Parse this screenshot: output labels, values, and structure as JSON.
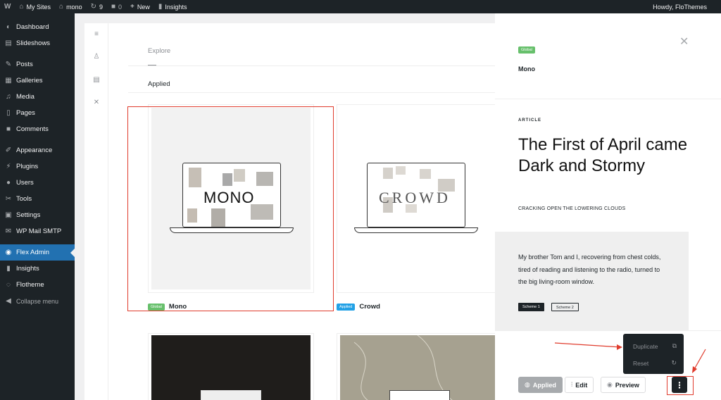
{
  "adminbar": {
    "wp_logo": "W",
    "my_sites": "My Sites",
    "site": "mono",
    "updates": "9",
    "comments": "0",
    "new": "New",
    "insights": "Insights",
    "howdy": "Howdy, FloThemes"
  },
  "sidebar": {
    "items": [
      {
        "label": "Dashboard",
        "icon": "dashboard-icon"
      },
      {
        "label": "Slideshows",
        "icon": "slideshows-icon"
      },
      {
        "label": "Posts",
        "icon": "pin-icon"
      },
      {
        "label": "Galleries",
        "icon": "gallery-icon"
      },
      {
        "label": "Media",
        "icon": "media-icon"
      },
      {
        "label": "Pages",
        "icon": "pages-icon"
      },
      {
        "label": "Comments",
        "icon": "comment-icon"
      },
      {
        "label": "Appearance",
        "icon": "brush-icon"
      },
      {
        "label": "Plugins",
        "icon": "plug-icon"
      },
      {
        "label": "Users",
        "icon": "user-icon"
      },
      {
        "label": "Tools",
        "icon": "wrench-icon"
      },
      {
        "label": "Settings",
        "icon": "settings-icon"
      },
      {
        "label": "WP Mail SMTP",
        "icon": "mail-icon"
      },
      {
        "label": "Flex Admin",
        "icon": "flex-icon"
      },
      {
        "label": "Insights",
        "icon": "chart-icon"
      },
      {
        "label": "Flotheme",
        "icon": "flotheme-icon"
      },
      {
        "label": "Collapse menu",
        "icon": "collapse-icon"
      }
    ]
  },
  "main": {
    "tab_explore": "Explore",
    "tab_applied": "Applied",
    "cards": [
      {
        "name": "Mono",
        "badge": "Global",
        "screen_text": "MONO"
      },
      {
        "name": "Crowd",
        "badge": "Applied",
        "screen_text": "CROWD"
      }
    ]
  },
  "panel": {
    "badge": "Global",
    "name": "Mono",
    "category": "ARTICLE",
    "title": "The First of April came Dark and Stormy",
    "subtitle": "CRACKING OPEN THE LOWERING CLOUDS",
    "body": "My brother Tom and I, recovering from chest colds, tired of reading and listening to the radio, turned to the big living-room window.",
    "scheme1": "Scheme 1",
    "scheme2": "Scheme 2",
    "dropdown": {
      "duplicate": "Duplicate",
      "reset": "Reset"
    },
    "buttons": {
      "applied": "Applied",
      "edit": "Edit",
      "preview": "Preview"
    }
  },
  "colors": {
    "adminbar": "#1d2327",
    "active_menu": "#2271b1",
    "global_badge": "#67c06c",
    "applied_badge": "#22a1e6",
    "annotation": "#e03c2d"
  }
}
